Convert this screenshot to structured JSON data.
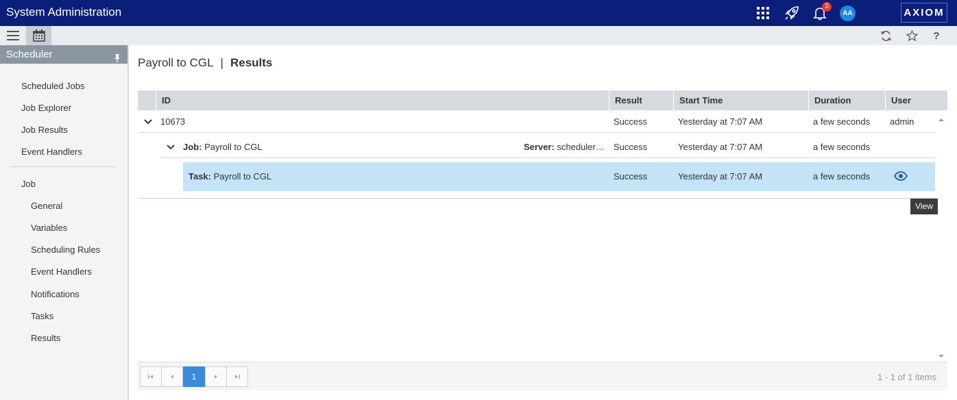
{
  "app": {
    "title": "System Administration",
    "logo": "AXIOM",
    "avatar_initials": "AA",
    "notification_count": "3"
  },
  "colors": {
    "topbar": "#0b1f7a",
    "selected_row": "#c4e3f7",
    "accent": "#3a8bd8"
  },
  "icons": [
    "apps-grid-icon",
    "rocket-icon",
    "bell-icon",
    "menu-icon",
    "calendar-icon",
    "refresh-icon",
    "star-icon",
    "help-icon",
    "pin-icon",
    "eye-icon"
  ],
  "sidebar": {
    "header": "Scheduler",
    "top_links": [
      "Scheduled Jobs",
      "Job Explorer",
      "Job Results",
      "Event Handlers"
    ],
    "job_label": "Job",
    "job_links": [
      "General",
      "Variables",
      "Scheduling Rules",
      "Event Handlers",
      "Notifications",
      "Tasks",
      "Results"
    ]
  },
  "page": {
    "title": "Payroll to CGL",
    "separator": "|",
    "subtitle": "Results"
  },
  "grid": {
    "columns": [
      "ID",
      "Result",
      "Start Time",
      "Duration",
      "User"
    ],
    "row": {
      "id": "10673",
      "result": "Success",
      "start_time": "Yesterday at 7:07 AM",
      "duration": "a few seconds",
      "user": "admin"
    },
    "job_row": {
      "label": "Job:",
      "name": "Payroll to CGL",
      "server_label": "Server:",
      "server": "scheduler…",
      "result": "Success",
      "start_time": "Yesterday at 7:07 AM",
      "duration": "a few seconds"
    },
    "task_row": {
      "label": "Task:",
      "name": "Payroll to CGL",
      "result": "Success",
      "start_time": "Yesterday at 7:07 AM",
      "duration": "a few seconds"
    },
    "tooltip": "View"
  },
  "pager": {
    "current_page": "1",
    "info": "1 - 1 of 1 items"
  }
}
